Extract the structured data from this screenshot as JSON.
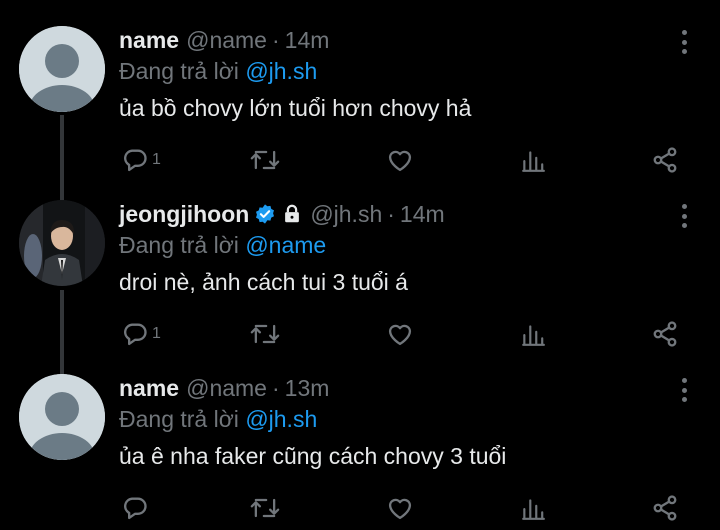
{
  "thread": [
    {
      "display_name": "name",
      "handle": "@name",
      "separator": "·",
      "time": "14m",
      "verified": false,
      "protected": false,
      "avatar": "default-avatar",
      "reply_prefix": "Đang trả lời",
      "reply_to": "@jh.sh",
      "text": "ủa bồ chovy lớn tuổi hơn chovy hả",
      "reply_count": "1",
      "retweet_count": "",
      "like_count": "",
      "view_count": ""
    },
    {
      "display_name": "jeongjihoon",
      "handle": "@jh.sh",
      "separator": "·",
      "time": "14m",
      "verified": true,
      "protected": true,
      "avatar": "photo-avatar",
      "reply_prefix": "Đang trả lời",
      "reply_to": "@name",
      "text": "droi nè, ảnh cách tui 3 tuổi á",
      "reply_count": "1",
      "retweet_count": "",
      "like_count": "",
      "view_count": ""
    },
    {
      "display_name": "name",
      "handle": "@name",
      "separator": "·",
      "time": "13m",
      "verified": false,
      "protected": false,
      "avatar": "default-avatar",
      "reply_prefix": "Đang trả lời",
      "reply_to": "@jh.sh",
      "text": "ủa ê nha faker cũng cách chovy 3 tuổi",
      "reply_count": "",
      "retweet_count": "",
      "like_count": "",
      "view_count": ""
    }
  ],
  "icons": {
    "reply": "reply-icon",
    "retweet": "retweet-icon",
    "like": "heart-icon",
    "views": "views-chart-icon",
    "share": "share-icon",
    "more": "more-options-icon",
    "verified": "verified-badge-icon",
    "protected": "lock-icon"
  },
  "colors": {
    "background": "#000000",
    "text_primary": "#e7e9ea",
    "text_secondary": "#71767b",
    "accent": "#1d9bf0",
    "thread_line": "#333639"
  }
}
